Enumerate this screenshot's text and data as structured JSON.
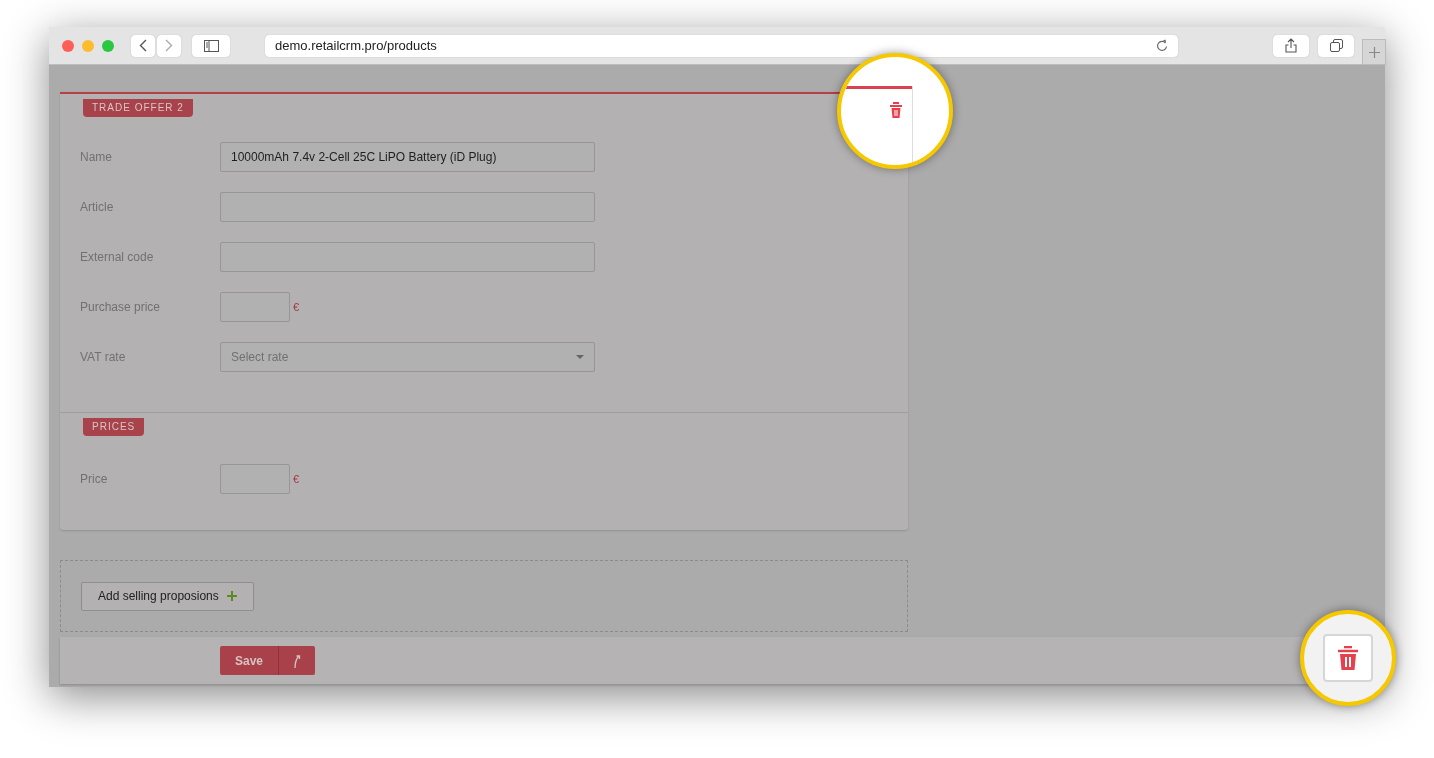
{
  "browser": {
    "url": "demo.retailcrm.pro/products"
  },
  "trade_offer": {
    "tag": "TRADE OFFER 2",
    "fields": [
      {
        "label": "Name",
        "kind": "text",
        "value": "10000mAh 7.4v 2-Cell 25C LiPO Battery (iD Plug)"
      },
      {
        "label": "Article",
        "kind": "text"
      },
      {
        "label": "External code",
        "kind": "text"
      },
      {
        "label": "Purchase price",
        "kind": "price",
        "currency": "€"
      },
      {
        "label": "VAT rate",
        "kind": "select",
        "placeholder": "Select rate"
      }
    ]
  },
  "prices": {
    "tag": "PRICES",
    "fields": [
      {
        "label": "Price",
        "kind": "price",
        "currency": "€"
      }
    ]
  },
  "add_button": {
    "label": "Add selling proposions"
  },
  "save_button": {
    "label": "Save"
  }
}
